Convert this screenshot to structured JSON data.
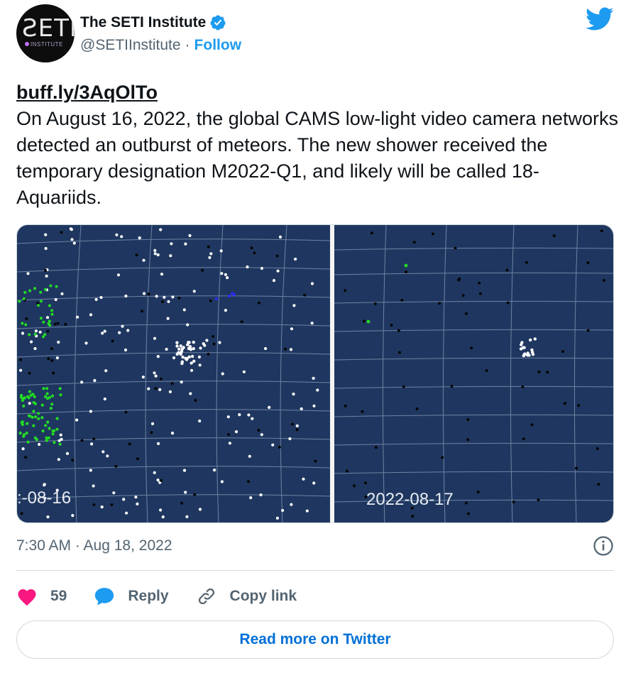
{
  "account": {
    "display_name": "The SETI Institute",
    "handle": "@SETIInstitute",
    "separator": "·",
    "follow_label": "Follow",
    "avatar_text": "ƧETI",
    "avatar_subtext": "INSTITUTE"
  },
  "tweet": {
    "link": "buff.ly/3AqOlTo",
    "text": "On August 16, 2022, the global CAMS low-light video camera networks detected an outburst of meteors. The new shower received the temporary designation M2022-Q1, and likely will be called 18-Aquariids."
  },
  "media": {
    "left_label": ":-08-16",
    "right_label": "2022-08-17",
    "colors": {
      "sky": "#1f3760",
      "grid": "#8a9bb8",
      "white_dot": "#ffffff",
      "black_dot": "#050505",
      "green_dot": "#22dd22",
      "blue_dot": "#2a2aff"
    }
  },
  "meta": {
    "timestamp": "7:30 AM · Aug 18, 2022"
  },
  "actions": {
    "like_count": "59",
    "reply_label": "Reply",
    "copy_label": "Copy link"
  },
  "footer": {
    "read_more_label": "Read more on Twitter"
  },
  "icons": [
    "verified-badge-icon",
    "twitter-bird-icon",
    "info-icon",
    "heart-icon",
    "reply-bubble-icon",
    "link-icon"
  ],
  "colors": {
    "accent": "#1d9bf0",
    "link_blue": "#006fd6",
    "heart": "#f91880",
    "muted": "#536471"
  }
}
